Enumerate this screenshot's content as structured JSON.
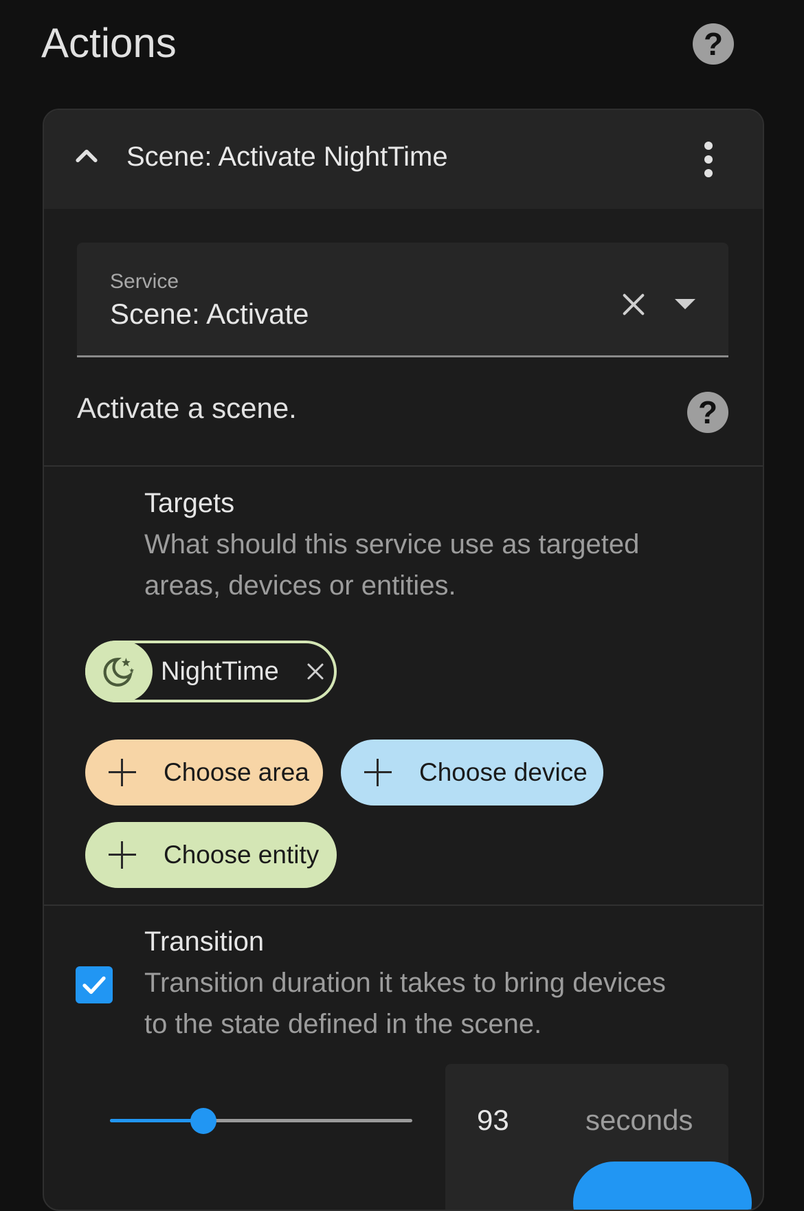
{
  "page": {
    "title": "Actions"
  },
  "action": {
    "title": "Scene: Activate NightTime",
    "service": {
      "label": "Service",
      "value": "Scene: Activate"
    },
    "description": "Activate a scene."
  },
  "targets": {
    "title": "Targets",
    "description": "What should this service use as targeted areas, devices or entities.",
    "selected": [
      {
        "label": "NightTime",
        "icon": "weather-night-icon"
      }
    ],
    "buttons": {
      "area": "Choose area",
      "device": "Choose device",
      "entity": "Choose entity"
    }
  },
  "transition": {
    "title": "Transition",
    "description": "Transition duration it takes to bring devices to the state defined in the scene.",
    "checked": true,
    "value": "93",
    "unit": "seconds",
    "slider_fraction": 0.31
  },
  "colors": {
    "accent": "#2196f3",
    "area_chip": "#f7d5a6",
    "device_chip": "#b5def5",
    "entity_chip": "#d4e6b5",
    "background": "#111111",
    "card": "#1c1c1c"
  }
}
